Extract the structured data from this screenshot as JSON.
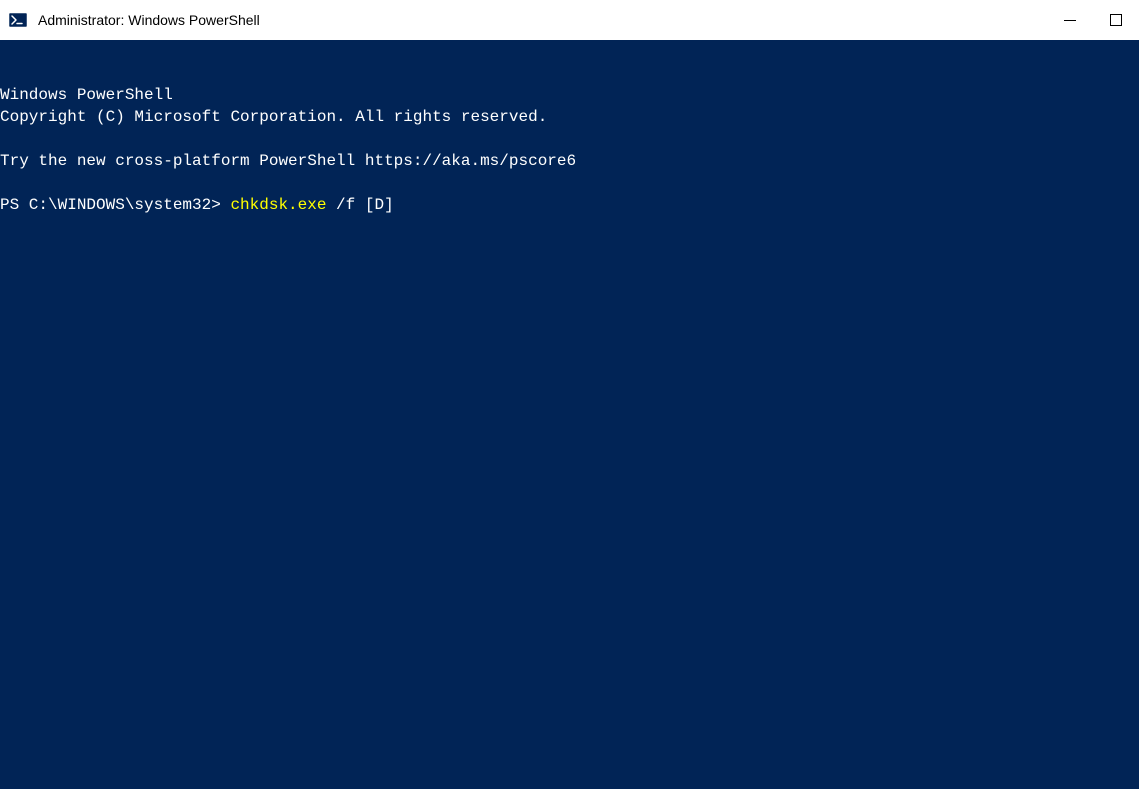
{
  "window": {
    "title": "Administrator: Windows PowerShell"
  },
  "terminal": {
    "line1": "Windows PowerShell",
    "line2": "Copyright (C) Microsoft Corporation. All rights reserved.",
    "line3": "",
    "line4": "Try the new cross-platform PowerShell https://aka.ms/pscore6",
    "line5": "",
    "prompt": "PS C:\\WINDOWS\\system32> ",
    "command": "chkdsk.exe",
    "args": " /f [D]"
  },
  "colors": {
    "terminal_bg": "#012456",
    "terminal_fg": "#ffffff",
    "command_color": "#ffff00"
  }
}
